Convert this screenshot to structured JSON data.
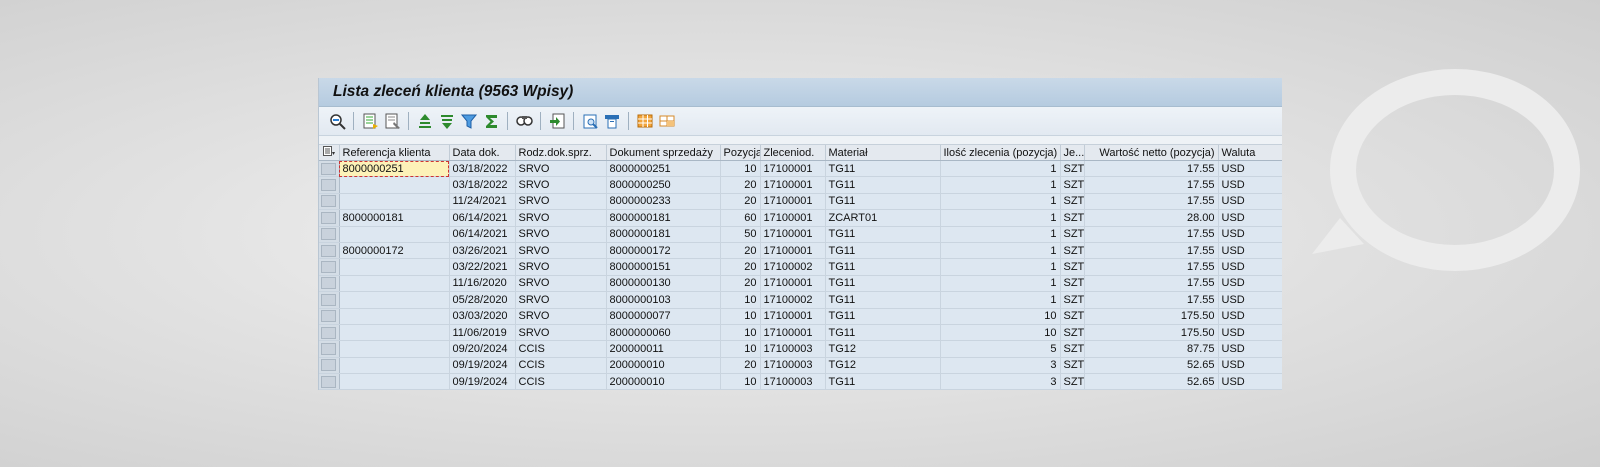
{
  "window": {
    "title": "Lista zleceń klienta (9563 Wpisy)"
  },
  "toolbar": {
    "buttons": [
      {
        "icon": "details-icon"
      },
      {
        "sep": true
      },
      {
        "icon": "select-layout-icon"
      },
      {
        "icon": "change-layout-icon"
      },
      {
        "sep": true
      },
      {
        "icon": "sort-ascending-icon"
      },
      {
        "icon": "sort-descending-icon"
      },
      {
        "icon": "filter-icon"
      },
      {
        "icon": "sum-icon"
      },
      {
        "sep": true
      },
      {
        "icon": "find-icon"
      },
      {
        "sep": true
      },
      {
        "icon": "export-icon"
      },
      {
        "sep": true
      },
      {
        "icon": "print-preview-icon"
      },
      {
        "icon": "print-icon"
      },
      {
        "sep": true
      },
      {
        "icon": "spreadsheet-view-icon"
      },
      {
        "icon": "abc-analysis-icon"
      }
    ]
  },
  "table": {
    "columns": [
      "Referencja klienta",
      "Data dok.",
      "Rodz.dok.sprz.",
      "Dokument sprzedaży",
      "Pozycja",
      "Zleceniod.",
      "Materiał",
      "Ilość zlecenia (pozycja)",
      "Je...",
      "Wartość netto (pozycja)",
      "Waluta"
    ],
    "rows": [
      [
        "8000000251",
        "03/18/2022",
        "SRVO",
        "8000000251",
        "10",
        "17100001",
        "TG11",
        "1",
        "SZT",
        "17.55",
        "USD"
      ],
      [
        "",
        "03/18/2022",
        "SRVO",
        "8000000250",
        "20",
        "17100001",
        "TG11",
        "1",
        "SZT",
        "17.55",
        "USD"
      ],
      [
        "",
        "11/24/2021",
        "SRVO",
        "8000000233",
        "20",
        "17100001",
        "TG11",
        "1",
        "SZT",
        "17.55",
        "USD"
      ],
      [
        "8000000181",
        "06/14/2021",
        "SRVO",
        "8000000181",
        "60",
        "17100001",
        "ZCART01",
        "1",
        "SZT",
        "28.00",
        "USD"
      ],
      [
        "",
        "06/14/2021",
        "SRVO",
        "8000000181",
        "50",
        "17100001",
        "TG11",
        "1",
        "SZT",
        "17.55",
        "USD"
      ],
      [
        "8000000172",
        "03/26/2021",
        "SRVO",
        "8000000172",
        "20",
        "17100001",
        "TG11",
        "1",
        "SZT",
        "17.55",
        "USD"
      ],
      [
        "",
        "03/22/2021",
        "SRVO",
        "8000000151",
        "20",
        "17100002",
        "TG11",
        "1",
        "SZT",
        "17.55",
        "USD"
      ],
      [
        "",
        "11/16/2020",
        "SRVO",
        "8000000130",
        "20",
        "17100001",
        "TG11",
        "1",
        "SZT",
        "17.55",
        "USD"
      ],
      [
        "",
        "05/28/2020",
        "SRVO",
        "8000000103",
        "10",
        "17100002",
        "TG11",
        "1",
        "SZT",
        "17.55",
        "USD"
      ],
      [
        "",
        "03/03/2020",
        "SRVO",
        "8000000077",
        "10",
        "17100001",
        "TG11",
        "10",
        "SZT",
        "175.50",
        "USD"
      ],
      [
        "",
        "11/06/2019",
        "SRVO",
        "8000000060",
        "10",
        "17100001",
        "TG11",
        "10",
        "SZT",
        "175.50",
        "USD"
      ],
      [
        "",
        "09/20/2024",
        "CCIS",
        "200000011",
        "10",
        "17100003",
        "TG12",
        "5",
        "SZT",
        "87.75",
        "USD"
      ],
      [
        "",
        "09/19/2024",
        "CCIS",
        "200000010",
        "20",
        "17100003",
        "TG12",
        "3",
        "SZT",
        "52.65",
        "USD"
      ],
      [
        "",
        "09/19/2024",
        "CCIS",
        "200000010",
        "10",
        "17100003",
        "TG11",
        "3",
        "SZT",
        "52.65",
        "USD"
      ]
    ]
  }
}
